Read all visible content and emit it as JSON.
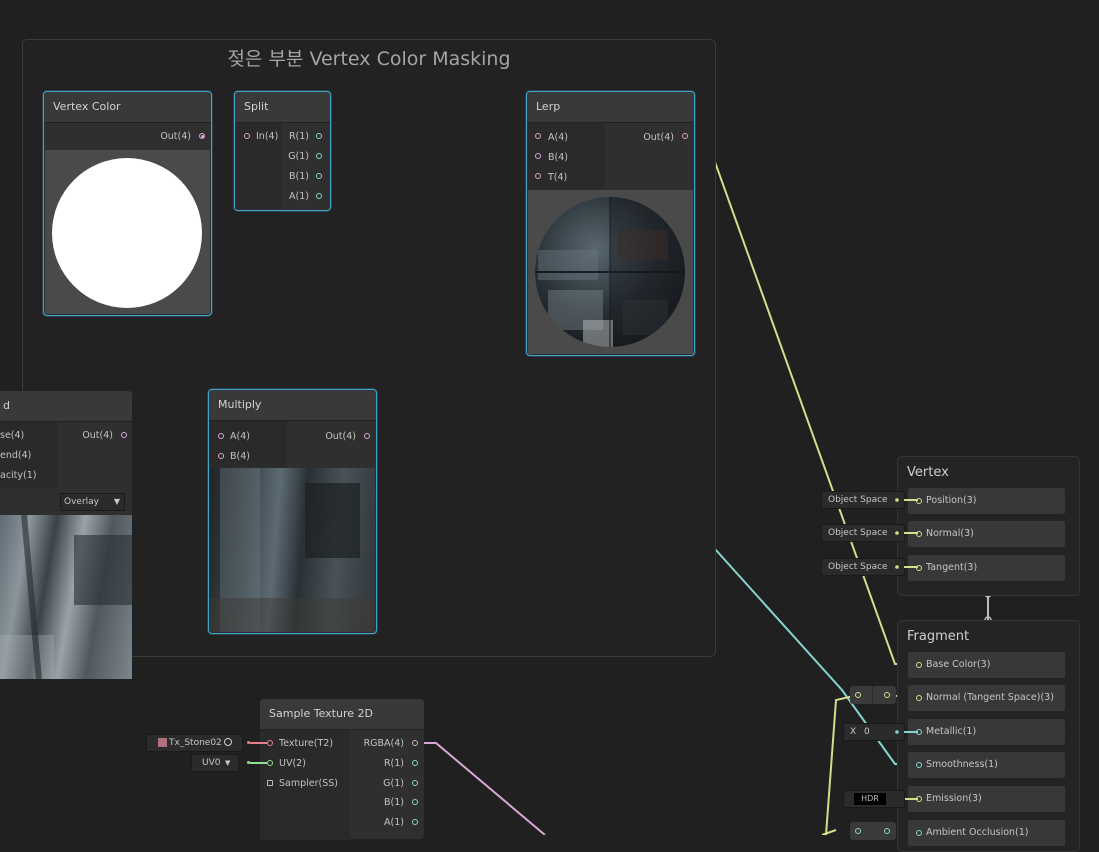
{
  "group": {
    "title": "젖은 부분 Vertex Color Masking"
  },
  "nodes": {
    "vertex_color": {
      "title": "Vertex Color",
      "out": "Out(4)"
    },
    "split": {
      "title": "Split",
      "in": "In(4)",
      "outs": [
        "R(1)",
        "G(1)",
        "B(1)",
        "A(1)"
      ]
    },
    "lerp": {
      "title": "Lerp",
      "ins": [
        "A(4)",
        "B(4)",
        "T(4)"
      ],
      "out": "Out(4)"
    },
    "blend": {
      "title": "d",
      "ins": [
        "se(4)",
        "end(4)",
        "acity(1)"
      ],
      "out": "Out(4)",
      "mode": "Overlay"
    },
    "multiply": {
      "title": "Multiply",
      "ins": [
        "A(4)",
        "B(4)"
      ],
      "out": "Out(4)"
    },
    "sample_texture": {
      "title": "Sample Texture 2D",
      "ins": [
        "Texture(T2)",
        "UV(2)",
        "Sampler(SS)"
      ],
      "outs": [
        "RGBA(4)",
        "R(1)",
        "G(1)",
        "B(1)",
        "A(1)"
      ],
      "texture_field": "Tx_Stone02",
      "uv_field": "UV0"
    }
  },
  "master": {
    "vertex": {
      "title": "Vertex",
      "slots": [
        "Position(3)",
        "Normal(3)",
        "Tangent(3)"
      ],
      "space_labels": [
        "Object Space",
        "Object Space",
        "Object Space"
      ]
    },
    "fragment": {
      "title": "Fragment",
      "slots": [
        "Base Color(3)",
        "Normal (Tangent Space)(3)",
        "Metallic(1)",
        "Smoothness(1)",
        "Emission(3)",
        "Ambient Occlusion(1)"
      ],
      "metallic_axis": "X",
      "metallic_value": "0",
      "emission_mode": "HDR"
    }
  },
  "colors": {
    "background": "#202020",
    "node": "#2f2f2f",
    "selection": "#44a3c9",
    "wire_vector4": "#d7a8d4",
    "wire_float": "#86d6d0",
    "wire_vector3": "#d6dc8a"
  },
  "icons": {
    "texture_swatch": "texture-thumbnail-icon",
    "picker": "object-picker-icon",
    "dropdown": "chevron-down-icon"
  }
}
